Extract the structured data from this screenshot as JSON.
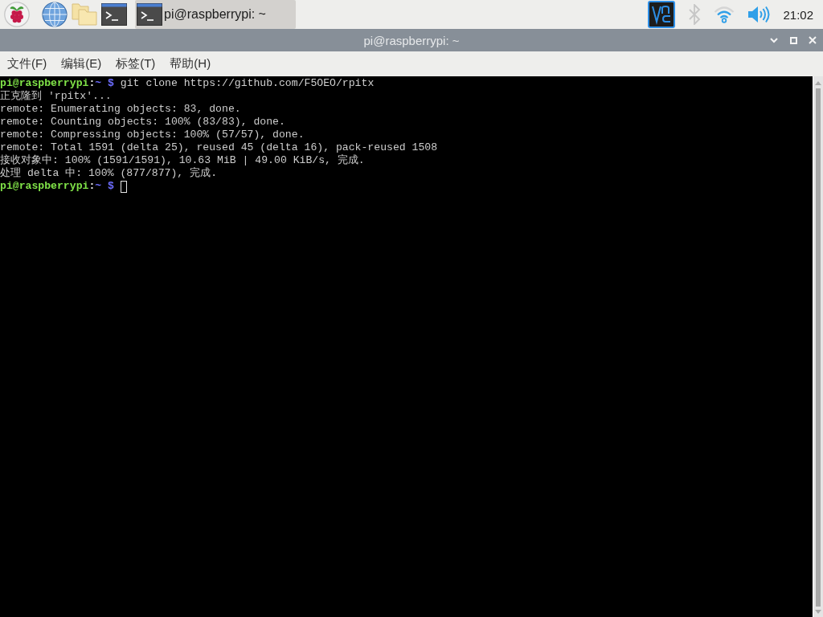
{
  "taskbar": {
    "tasks": [
      {
        "label": "pi@raspberrypi: ~",
        "selected": true
      }
    ],
    "tray": {
      "bluetooth_enabled": false,
      "clock": "21:02"
    }
  },
  "window": {
    "title": "pi@raspberrypi: ~"
  },
  "menu": [
    "文件(F)",
    "编辑(E)",
    "标签(T)",
    "帮助(H)"
  ],
  "terminal": {
    "lines": [
      {
        "kind": "prompt",
        "user_host": "pi@raspberrypi",
        "separator": ":",
        "path": "~",
        "symbol": "$",
        "command": "git clone https://github.com/F5OEO/rpitx",
        "cursor": false
      },
      {
        "kind": "output",
        "text": "正克隆到 'rpitx'..."
      },
      {
        "kind": "output",
        "text": "remote: Enumerating objects: 83, done."
      },
      {
        "kind": "output",
        "text": "remote: Counting objects: 100% (83/83), done."
      },
      {
        "kind": "output",
        "text": "remote: Compressing objects: 100% (57/57), done."
      },
      {
        "kind": "output",
        "text": "remote: Total 1591 (delta 25), reused 45 (delta 16), pack-reused 1508"
      },
      {
        "kind": "output",
        "text": "接收对象中: 100% (1591/1591), 10.63 MiB | 49.00 KiB/s, 完成."
      },
      {
        "kind": "output",
        "text": "处理 delta 中: 100% (877/877), 完成."
      },
      {
        "kind": "prompt",
        "user_host": "pi@raspberrypi",
        "separator": ":",
        "path": "~",
        "symbol": "$",
        "cursor": true
      }
    ]
  }
}
